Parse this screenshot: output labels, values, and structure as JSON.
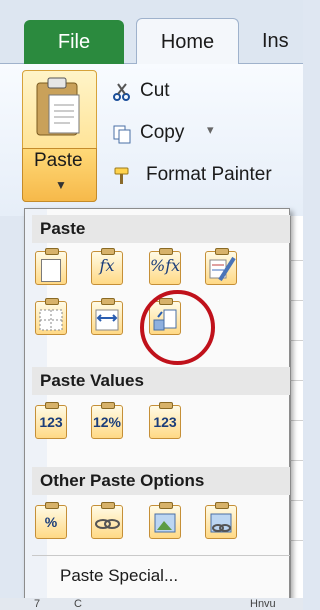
{
  "tabs": {
    "file": "File",
    "home": "Home",
    "insert_partial": "Ins"
  },
  "clipboard": {
    "paste_label": "Paste",
    "cut_label": "Cut",
    "copy_label": "Copy",
    "copy_arrow": "▾",
    "format_painter_label": "Format Painter",
    "paste_arrow": "▼"
  },
  "paste_menu": {
    "section_paste": "Paste",
    "section_values": "Paste Values",
    "section_other": "Other Paste Options",
    "paste_special": "Paste Special...",
    "paste_icons": [
      "paste-icon",
      "paste-formulas-icon",
      "paste-formulas-number-formatting-icon",
      "keep-source-formatting-icon",
      "no-borders-icon",
      "keep-source-column-widths-icon",
      "transpose-icon"
    ],
    "values_icons": [
      "paste-values-icon",
      "values-number-formatting-icon",
      "values-source-formatting-icon"
    ],
    "other_icons": [
      "paste-formatting-icon",
      "paste-link-icon",
      "paste-picture-icon",
      "linked-picture-icon"
    ],
    "highlighted": "transpose-icon"
  },
  "bottom": {
    "left": "7",
    "mid": "C",
    "right": "Hnvu"
  },
  "colors": {
    "file_tab": "#2b8a3e",
    "highlight_circle": "#c0111b",
    "button_gold": "#ffd978"
  }
}
